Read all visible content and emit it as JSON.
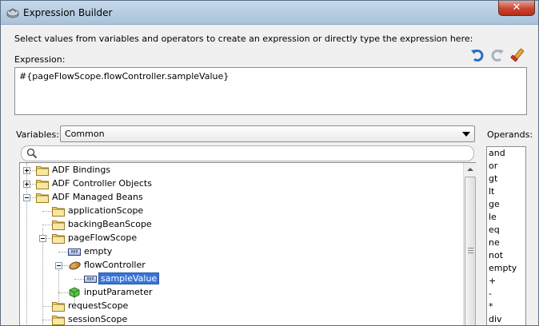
{
  "window": {
    "title": "Expression Builder",
    "close_glyph": "✕"
  },
  "instruction": "Select values from variables and operators to create an expression or directly type the expression here:",
  "expression": {
    "label": "Expression:",
    "value": "#{pageFlowScope.flowController.sampleValue}",
    "tools": [
      "undo-icon",
      "redo-icon",
      "clear-icon"
    ]
  },
  "variables": {
    "label": "Variables:",
    "selected": "Common",
    "search_placeholder": ""
  },
  "operands": {
    "label": "Operands:",
    "items": [
      "and",
      "or",
      "gt",
      "lt",
      "ge",
      "le",
      "eq",
      "ne",
      "not",
      "empty",
      "+",
      "-",
      "*",
      "div"
    ]
  },
  "tree": {
    "items": [
      {
        "label": "ADF Bindings",
        "icon": "folder-icon"
      },
      {
        "label": "ADF Controller Objects",
        "icon": "folder-icon"
      },
      {
        "label": "ADF Managed Beans",
        "icon": "folder-icon"
      },
      {
        "label": "applicationScope",
        "icon": "folder-icon"
      },
      {
        "label": "backingBeanScope",
        "icon": "folder-icon"
      },
      {
        "label": "pageFlowScope",
        "icon": "folder-icon"
      },
      {
        "label": "empty",
        "icon": "xyz-icon"
      },
      {
        "label": "flowController",
        "icon": "bean-icon"
      },
      {
        "label": "sampleValue",
        "icon": "xyz-icon"
      },
      {
        "label": "inputParameter",
        "icon": "cube-icon"
      },
      {
        "label": "requestScope",
        "icon": "folder-icon"
      },
      {
        "label": "sessionScope",
        "icon": "folder-icon"
      }
    ]
  },
  "colors": {
    "selection": "#3874d8",
    "titlebar": "#b4cbe3",
    "close": "#c9452f"
  }
}
